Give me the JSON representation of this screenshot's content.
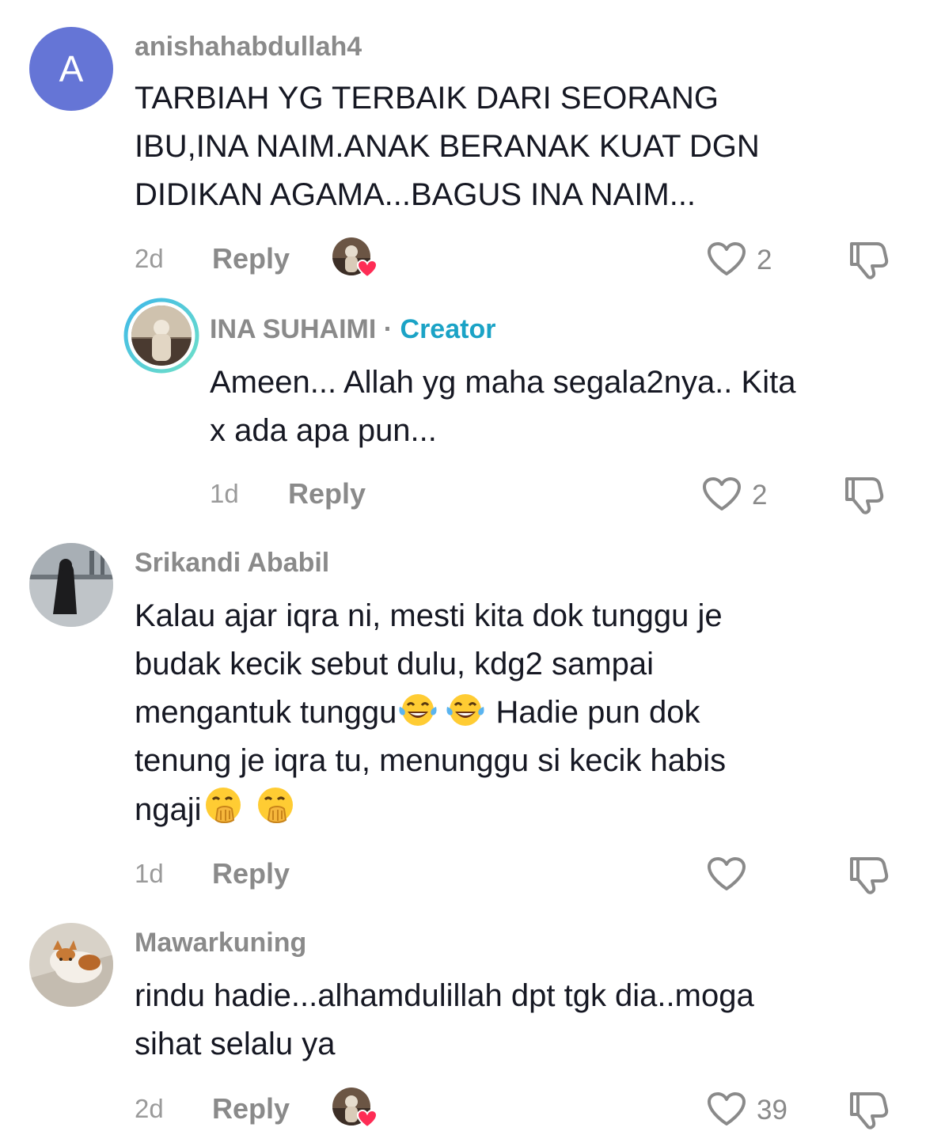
{
  "comments": [
    {
      "username": "anishahabdullah4",
      "avatar_letter": "A",
      "text_lines": [
        "TARBIAH YG TERBAIK DARI SEORANG",
        "IBU,INA NAIM.ANAK BERANAK KUAT DGN",
        "DIDIKAN AGAMA...BAGUS INA NAIM..."
      ],
      "time": "2d",
      "reply_label": "Reply",
      "likes": "2",
      "creator_liked": true
    },
    {
      "username": "INA SUHAIMI",
      "creator_sep": " · ",
      "creator_label": "Creator",
      "text_lines": [
        "Ameen... Allah yg maha segala2nya.. Kita",
        "x ada apa pun..."
      ],
      "time": "1d",
      "reply_label": "Reply",
      "likes": "2"
    },
    {
      "username": "Srikandi Ababil",
      "text_lines": [
        "Kalau ajar iqra ni, mesti kita dok tunggu je",
        "budak kecik sebut dulu, kdg2 sampai",
        "mengantuk tunggu",
        " Hadie pun dok",
        "tenung je iqra tu, menunggu si kecik habis",
        "ngaji"
      ],
      "emoji_1": "face-with-tears-of-joy",
      "emoji_2": "face-with-hand-over-mouth",
      "time": "1d",
      "reply_label": "Reply",
      "likes": ""
    },
    {
      "username": "Mawarkuning",
      "text_lines": [
        "rindu hadie...alhamdulillah dpt tgk dia..moga",
        "sihat selalu ya"
      ],
      "time": "2d",
      "reply_label": "Reply",
      "likes": "39",
      "creator_liked": true
    }
  ],
  "icons": {
    "like": "heart-outline-icon",
    "dislike": "thumbs-down-icon",
    "creator_liked": "creator-liked-avatar-icon"
  },
  "colors": {
    "creator_accent": "#1ba3c6",
    "avatar_letter_bg": "#6575d6",
    "heart_badge": "#fe2c55"
  }
}
